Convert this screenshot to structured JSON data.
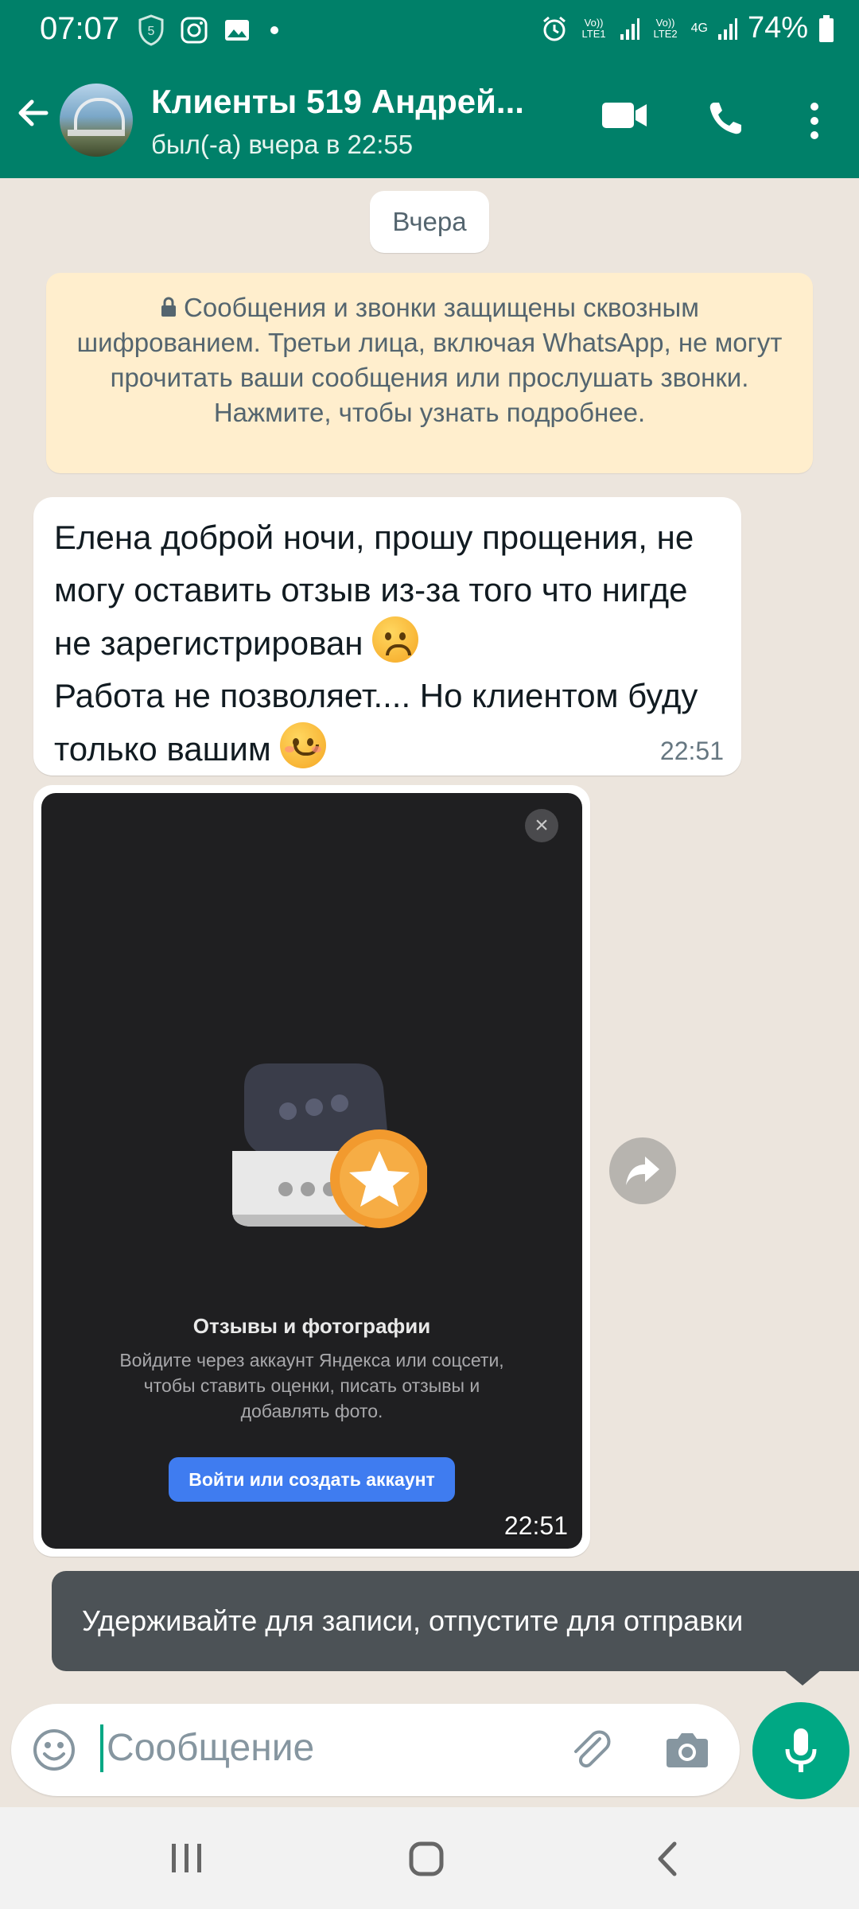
{
  "status_bar": {
    "time": "07:07",
    "net1": "Vo)) LTE1",
    "net2": "Vo)) LTE2",
    "net_gen": "4G",
    "battery": "74%"
  },
  "header": {
    "contact_name": "Клиенты 519 Андрей...",
    "last_seen": "был(-а) вчера в 22:55"
  },
  "chat": {
    "date_label": "Вчера",
    "encryption_notice": "Сообщения и звонки защищены сквозным шифрованием. Третьи лица, включая WhatsApp, не могут прочитать ваши сообщения или прослушать звонки. Нажмите, чтобы узнать подробнее.",
    "message1": {
      "line1": "Елена доброй ночи, прошу прощения, не могу оставить отзыв из-за того что нигде не зарегистрирован",
      "line2": "Работа не позволяет.... Но клиентом буду только вашим",
      "time": "22:51"
    },
    "image_message": {
      "heading": "Отзывы и фотографии",
      "description": "Войдите через аккаунт Яндекса или соцсети, чтобы ставить оценки, писать отзывы и добавлять фото.",
      "button_label": "Войти или создать аккаунт",
      "close_glyph": "×",
      "time": "22:51"
    }
  },
  "tooltip": {
    "text": "Удерживайте для записи, отпустите для отправки"
  },
  "composer": {
    "placeholder": "Сообщение"
  },
  "colors": {
    "header_bg": "#008069",
    "accent_green": "#00a884",
    "chat_bg": "#ECE5DD",
    "notice_bg": "#FFEECD",
    "bubble_bg": "#FFFFFF"
  },
  "icons": [
    "back-arrow-icon",
    "video-call-icon",
    "phone-icon",
    "more-vert-icon",
    "lock-icon",
    "forward-icon",
    "emoji-icon",
    "attach-icon",
    "camera-icon",
    "mic-icon",
    "recents-icon",
    "home-icon",
    "nav-back-icon"
  ]
}
